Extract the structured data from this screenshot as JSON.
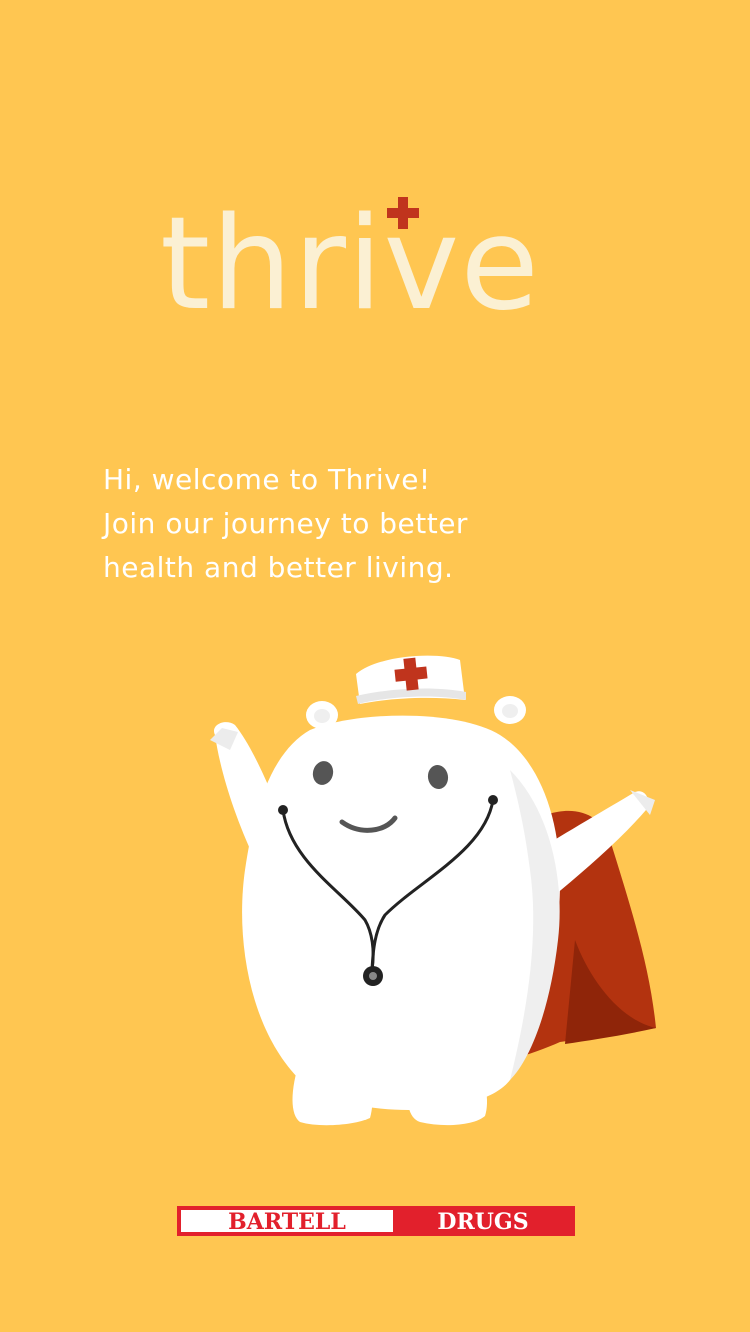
{
  "app": {
    "logo_text": "thrive",
    "welcome_lines": [
      "Hi, welcome to Thrive!",
      "Join our journey to better",
      "health and better living."
    ],
    "brand_left": "BARTELL",
    "brand_right": "DRUGS"
  },
  "colors": {
    "background": "#FFC651",
    "logo": "#FBF0D3",
    "cross": "#C0341D",
    "brand_red": "#E2202C"
  },
  "icons": {
    "logo_cross": "red-cross-icon",
    "mascot": "polar-bear-nurse-mascot"
  }
}
